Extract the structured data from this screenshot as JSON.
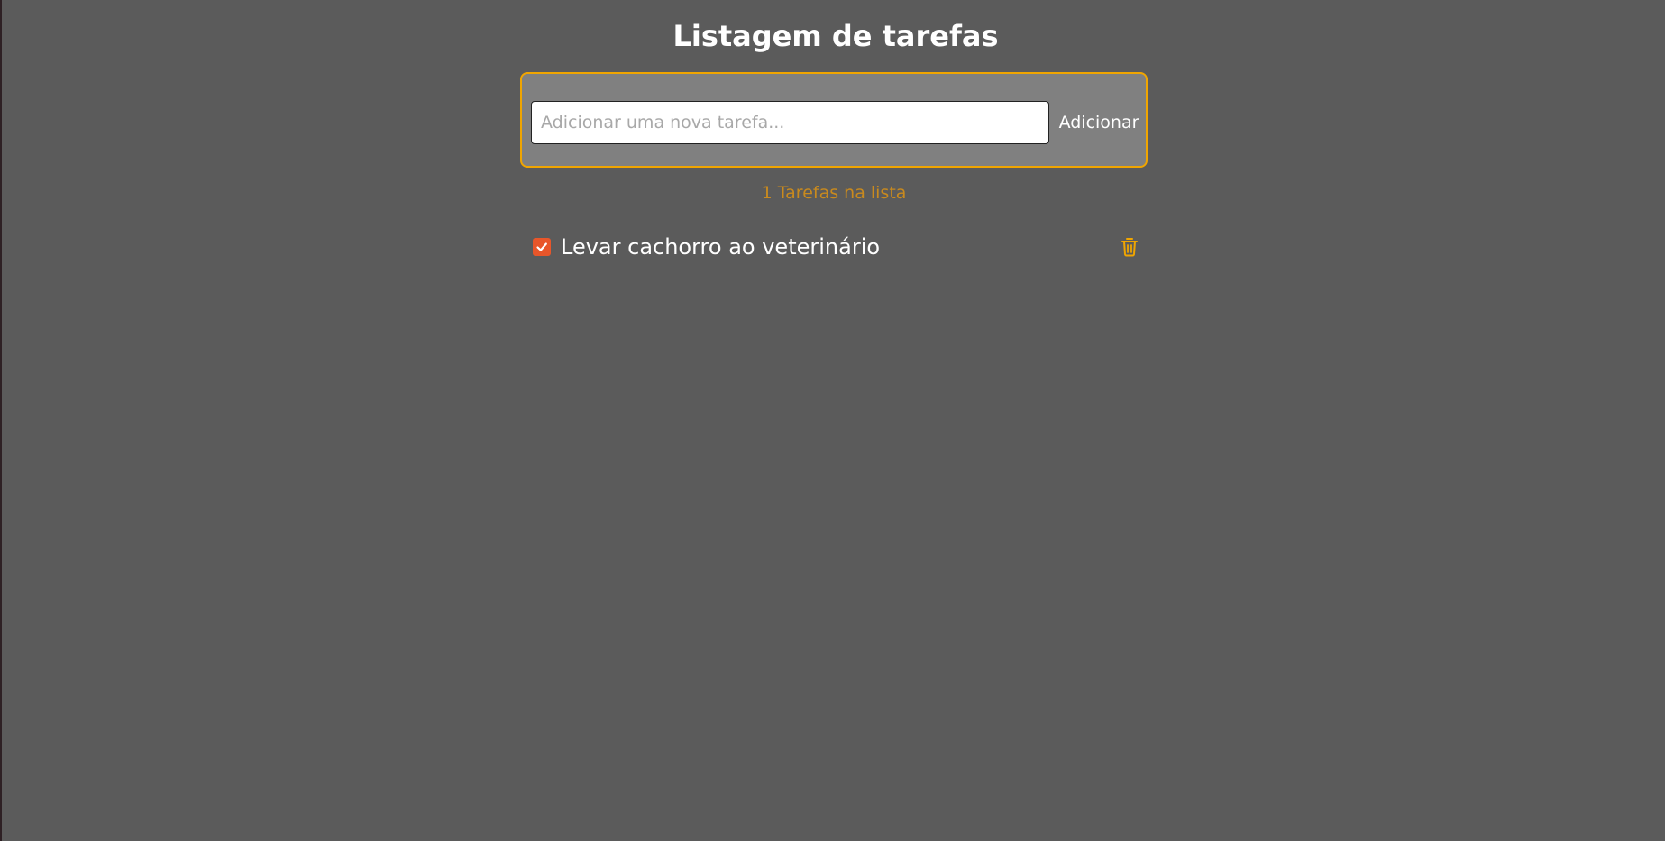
{
  "header": {
    "title": "Listagem de tarefas"
  },
  "add_form": {
    "input_value": "",
    "input_placeholder": "Adicionar uma nova tarefa...",
    "button_label": "Adicionar"
  },
  "summary": {
    "count_text": "1 Tarefas na lista"
  },
  "tasks": [
    {
      "label": "Levar cachorro ao veterinário",
      "checked": true,
      "check_icon": "check-icon",
      "delete_icon": "trash-icon"
    }
  ],
  "colors": {
    "background": "#5b5b5b",
    "panel": "#808080",
    "accent": "#f0a500",
    "count_text": "#c98a1e",
    "checkbox": "#e8562a"
  }
}
